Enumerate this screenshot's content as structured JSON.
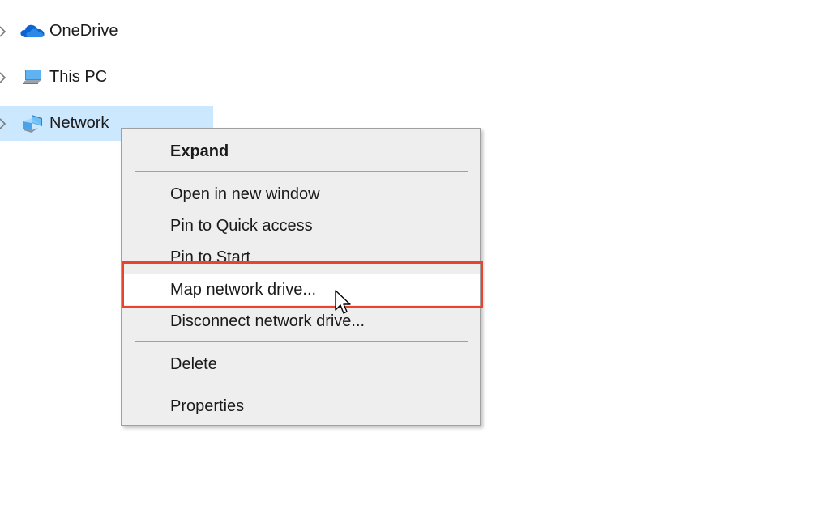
{
  "nav": {
    "items": [
      {
        "label": "OneDrive",
        "icon": "onedrive-cloud-icon"
      },
      {
        "label": "This PC",
        "icon": "this-pc-icon"
      },
      {
        "label": "Network",
        "icon": "network-icon",
        "selected": true
      }
    ]
  },
  "context_menu": {
    "items": [
      {
        "label": "Expand",
        "bold": true
      },
      {
        "label": "Open in new window"
      },
      {
        "label": "Pin to Quick access"
      },
      {
        "label": "Pin to Start"
      },
      {
        "label": "Map network drive...",
        "highlighted": true
      },
      {
        "label": "Disconnect network drive..."
      },
      {
        "label": "Delete"
      },
      {
        "label": "Properties"
      }
    ]
  },
  "colors": {
    "selection": "#cce8ff",
    "highlight_border": "#e8432d",
    "menu_background": "#eeeeee"
  }
}
